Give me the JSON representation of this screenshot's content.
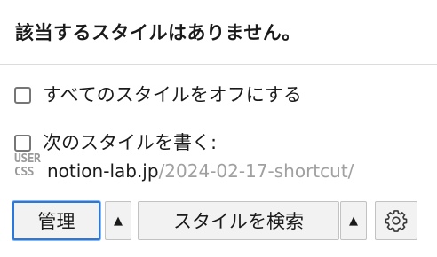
{
  "header": {
    "title": "該当するスタイルはありません。"
  },
  "options": {
    "disable_all_label": "すべてのスタイルをオフにする",
    "write_style_label": "次のスタイルを書く:"
  },
  "write_target": {
    "icon": "usercss-icon",
    "icon_text_top": "USER",
    "icon_text_bottom": "CSS",
    "host": "notion-lab.jp",
    "path": "/2024-02-17-shortcut/"
  },
  "footer": {
    "manage_label": "管理",
    "manage_menu_glyph": "▲",
    "find_styles_label": "スタイルを検索",
    "find_menu_glyph": "▲",
    "options_icon": "gear-icon"
  },
  "colors": {
    "focus_ring": "#2b78d8",
    "muted_text": "#a0a0a0"
  }
}
